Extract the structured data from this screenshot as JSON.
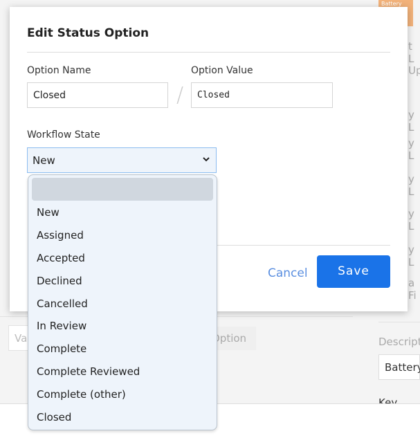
{
  "modal": {
    "title": "Edit Status Option",
    "option_name_label": "Option Name",
    "option_name_value": "Closed",
    "option_value_label": "Option Value",
    "option_value_value": "Closed",
    "separator": "/",
    "workflow_label": "Workflow State",
    "workflow_selected": "New",
    "cancel_label": "Cancel",
    "save_label": "Save"
  },
  "dropdown": {
    "options": [
      "",
      "New",
      "Assigned",
      "Accepted",
      "Declined",
      "Cancelled",
      "In Review",
      "Complete",
      "Complete Reviewed",
      "Complete (other)",
      "Closed"
    ]
  },
  "background": {
    "right_texts": [
      "t L",
      "Up",
      "y L",
      "y L",
      "y L",
      "y L",
      "y L",
      "a Fi"
    ],
    "badge": "Battery",
    "description_label": "Descript",
    "description_value": "Battery",
    "key_label": "Key",
    "value_placeholder": "Va",
    "add_option": "Option"
  },
  "colors": {
    "primary": "#1a73e8",
    "cancel": "#5b8fe0",
    "dropdown_bg": "#eef4fb"
  }
}
